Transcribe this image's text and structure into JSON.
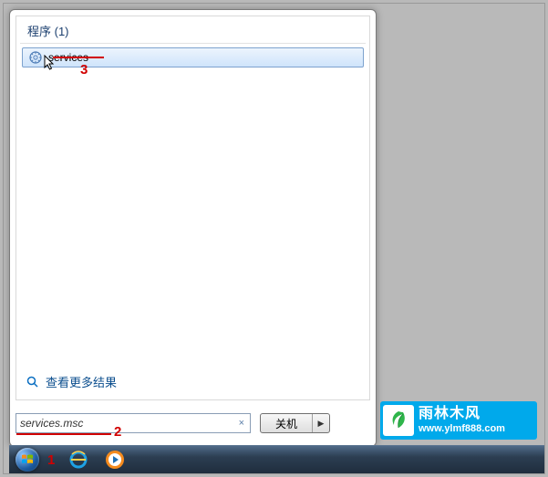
{
  "section_header": "程序 (1)",
  "results": [
    {
      "label": "services",
      "icon": "services-icon"
    }
  ],
  "annotations": {
    "result_underline_number": "3",
    "search_underline_number": "2",
    "taskbar_number": "1"
  },
  "see_more_label": "查看更多结果",
  "search": {
    "value": "services.msc",
    "clear_label": "×"
  },
  "shutdown": {
    "label": "关机",
    "arrow": "▶"
  },
  "watermark": {
    "brand_cn": "雨林木风",
    "url": "www.ylmf888.com"
  }
}
